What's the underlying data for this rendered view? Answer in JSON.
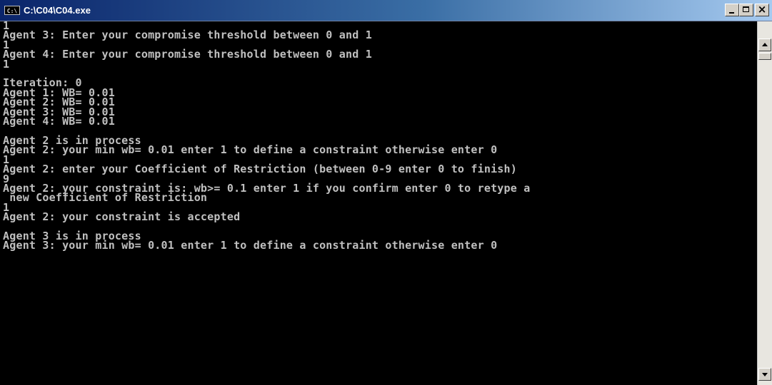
{
  "window": {
    "title": "C:\\C04\\C04.exe",
    "icon": "console-icon",
    "icon_text": "C:\\",
    "controls": {
      "minimize": "_",
      "maximize": "□",
      "close": "×"
    }
  },
  "console": {
    "lines": [
      "1",
      "Agent 3: Enter your compromise threshold between 0 and 1",
      "1",
      "Agent 4: Enter your compromise threshold between 0 and 1",
      "1",
      "",
      "Iteration: 0",
      "Agent 1: WB= 0.01",
      "Agent 2: WB= 0.01",
      "Agent 3: WB= 0.01",
      "Agent 4: WB= 0.01",
      "",
      "Agent 2 is in process",
      "Agent 2: your min wb= 0.01 enter 1 to define a constraint otherwise enter 0",
      "1",
      "Agent 2: enter your Coefficient of Restriction (between 0-9 enter 0 to finish)",
      "9",
      "Agent 2: your constraint is: wb>= 0.1 enter 1 if you confirm enter 0 to retype a",
      " new Coefficient of Restriction",
      "1",
      "Agent 2: your constraint is accepted",
      "",
      "Agent 3 is in process",
      "Agent 3: your min wb= 0.01 enter 1 to define a constraint otherwise enter 0"
    ],
    "text_color": "#c0c0c0",
    "background_color": "#000000"
  }
}
